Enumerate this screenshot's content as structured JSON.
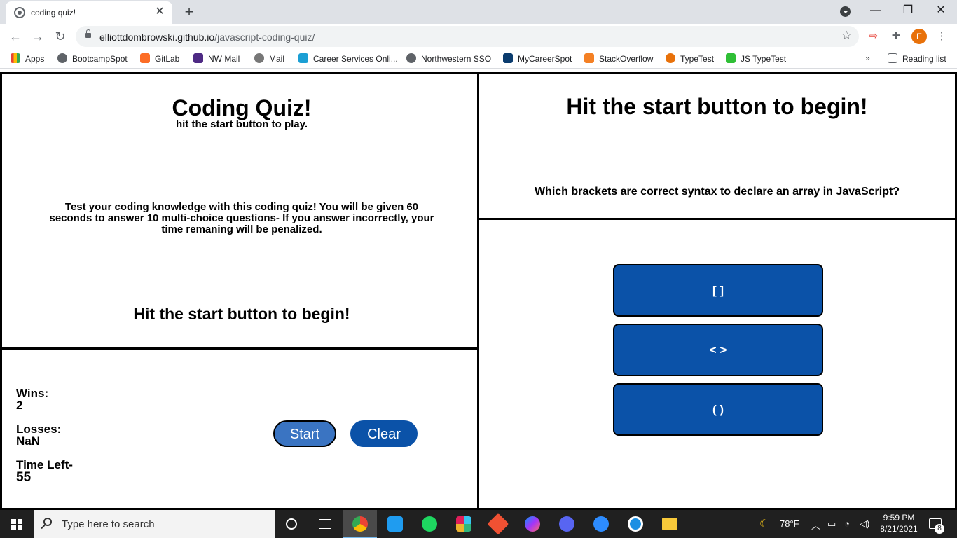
{
  "browser": {
    "tab_title": "coding quiz!",
    "tab_close": "✕",
    "new_tab": "+",
    "url_host": "elliottdombrowski.github.io",
    "url_path": "/javascript-coding-quiz/",
    "avatar_letter": "E",
    "bookmarks": [
      {
        "label": "Apps",
        "icon": "apps-grid-icon",
        "color": "#4285f4"
      },
      {
        "label": "BootcampSpot",
        "icon": "globe-icon",
        "color": "#5f6368"
      },
      {
        "label": "GitLab",
        "icon": "gitlab-icon",
        "color": "#fc6d26"
      },
      {
        "label": "NW Mail",
        "icon": "northwestern-n-icon",
        "color": "#4e2a84"
      },
      {
        "label": "Mail",
        "icon": "apple-icon",
        "color": "#777777"
      },
      {
        "label": "Career Services Onli...",
        "icon": "cs-icon",
        "color": "#1b9fd4"
      },
      {
        "label": "Northwestern SSO",
        "icon": "globe-icon",
        "color": "#5f6368"
      },
      {
        "label": "MyCareerSpot",
        "icon": "cs-icon",
        "color": "#0b3c6e"
      },
      {
        "label": "StackOverflow",
        "icon": "stackoverflow-icon",
        "color": "#f48024"
      },
      {
        "label": "TypeTest",
        "icon": "typetest-icon",
        "color": "#e8710a"
      },
      {
        "label": "JS TypeTest",
        "icon": "typetest-t-icon",
        "color": "#2fbf36"
      }
    ],
    "overflow_label": "»",
    "reading_list": "Reading list"
  },
  "intro": {
    "title": "Coding Quiz!",
    "subtitle": "hit the start button to play.",
    "description": "Test your coding knowledge with this coding quiz! You will be given 60 seconds to answer 10 multi-choice questions- If you answer incorrectly, your time remaning will be penalized.",
    "cta": "Hit the start button to begin!"
  },
  "stats": {
    "wins_label": "Wins:",
    "wins_value": "2",
    "losses_label": "Losses:",
    "losses_value": "NaN",
    "time_label": "Time Left-",
    "time_value": "55"
  },
  "controls": {
    "start_label": "Start",
    "clear_label": "Clear"
  },
  "question": {
    "heading": "Hit the start button to begin!",
    "text": "Which brackets are correct syntax to declare an array in JavaScript?",
    "answers": [
      "[ ]",
      "< >",
      "( )"
    ]
  },
  "taskbar": {
    "search_placeholder": "Type here to search",
    "weather": "78°F",
    "time": "9:59 PM",
    "date": "8/21/2021",
    "notification_count": "8"
  }
}
